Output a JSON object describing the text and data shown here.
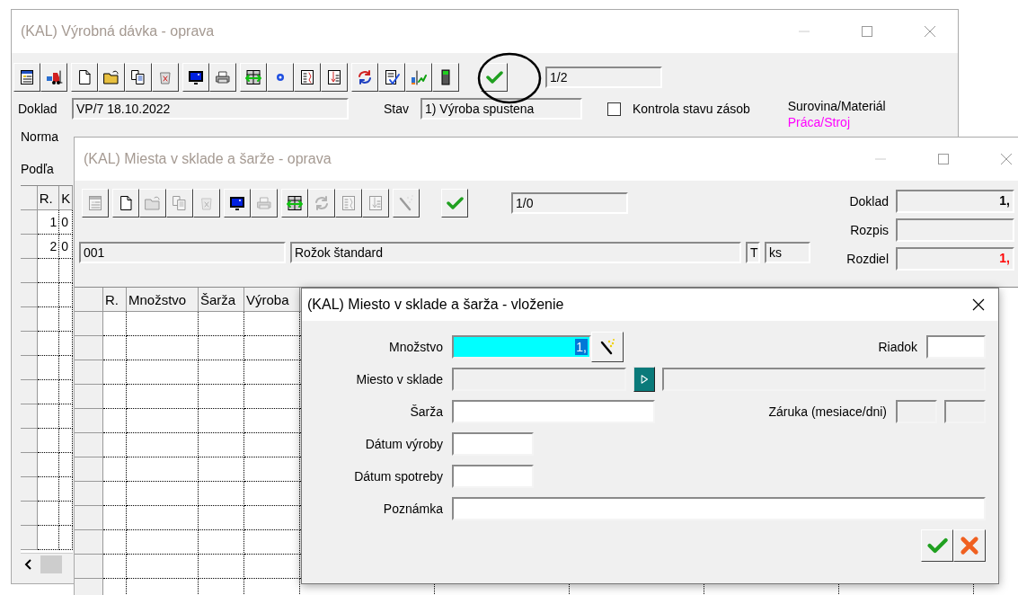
{
  "main_window": {
    "title": "(KAL) Výrobná dávka - oprava",
    "toolbar": [
      {
        "buttons": [
          {
            "kind": "doc-list"
          },
          {
            "kind": "forklift"
          }
        ]
      },
      {
        "buttons": [
          {
            "kind": "page"
          },
          {
            "kind": "folder"
          },
          {
            "kind": "copy"
          },
          {
            "kind": "trash"
          }
        ]
      },
      {
        "buttons": [
          {
            "kind": "monitor"
          },
          {
            "kind": "printer"
          }
        ]
      },
      {
        "buttons": [
          {
            "kind": "table-arrows"
          },
          {
            "kind": "dot"
          },
          {
            "kind": "book"
          },
          {
            "kind": "sort"
          }
        ]
      },
      {
        "buttons": [
          {
            "kind": "refresh"
          },
          {
            "kind": "doc-check"
          },
          {
            "kind": "chart"
          },
          {
            "kind": "phone"
          }
        ]
      },
      {
        "buttons": [
          {
            "kind": "check"
          }
        ]
      }
    ],
    "counter": "1/2",
    "doklad": {
      "label": "Doklad",
      "value": "VP/7 18.10.2022"
    },
    "stav": {
      "label": "Stav",
      "value": "1) Výroba spustena"
    },
    "stock_check": {
      "label": "Kontrola stavu zásob",
      "checked": false
    },
    "legend": [
      {
        "text": "Surovina/Materiál",
        "color": "#000000"
      },
      {
        "text": "Práca/Stroj",
        "color": "#ff00ff"
      }
    ],
    "norma_label": "Norma",
    "podla_label": "Podľa",
    "grid": {
      "columns": [
        "R.",
        "K"
      ],
      "rows": [
        [
          "1",
          "0"
        ],
        [
          "2",
          "0"
        ]
      ]
    }
  },
  "locations_window": {
    "title": "(KAL) Miesta v sklade a šarže - oprava",
    "toolbar": [
      {
        "buttons": [
          {
            "kind": "doc-list",
            "disabled": true
          }
        ]
      },
      {
        "buttons": [
          {
            "kind": "page",
            "disabled": false
          },
          {
            "kind": "folder",
            "disabled": true
          },
          {
            "kind": "copy",
            "disabled": true
          },
          {
            "kind": "trash",
            "disabled": true
          }
        ]
      },
      {
        "buttons": [
          {
            "kind": "monitor",
            "disabled": false
          },
          {
            "kind": "printer",
            "disabled": true
          }
        ]
      },
      {
        "buttons": [
          {
            "kind": "table-arrows",
            "disabled": false
          },
          {
            "kind": "refresh",
            "disabled": true
          },
          {
            "kind": "book",
            "disabled": true
          },
          {
            "kind": "sort",
            "disabled": true
          }
        ]
      },
      {
        "buttons": [
          {
            "kind": "wand",
            "disabled": true
          }
        ]
      },
      {
        "buttons": [
          {
            "kind": "check",
            "disabled": false
          }
        ]
      }
    ],
    "counter": "1/0",
    "item_code": "001",
    "item_name": "Rožok štandard",
    "item_type": "T",
    "unit": "ks",
    "totals": [
      {
        "label": "Doklad",
        "value": "1,",
        "color": "#000000"
      },
      {
        "label": "Rozpis"
      },
      {
        "label": "Rozdiel",
        "value": "1,",
        "color": "#ff0000"
      }
    ],
    "grid": {
      "columns": [
        "R.",
        "Množstvo",
        "Šarža",
        "Výroba"
      ]
    }
  },
  "insert_dialog": {
    "title": "(KAL) Miesto v sklade a šarža - vloženie",
    "quantity": {
      "label": "Množstvo",
      "value": "1,"
    },
    "row": {
      "label": "Riadok"
    },
    "location": {
      "label": "Miesto v sklade"
    },
    "batch": {
      "label": "Šarža"
    },
    "warranty": {
      "label": "Záruka (mesiace/dni)"
    },
    "production_date": {
      "label": "Dátum výroby"
    },
    "expiry_date": {
      "label": "Dátum spotreby"
    },
    "note": {
      "label": "Poznámka"
    }
  }
}
